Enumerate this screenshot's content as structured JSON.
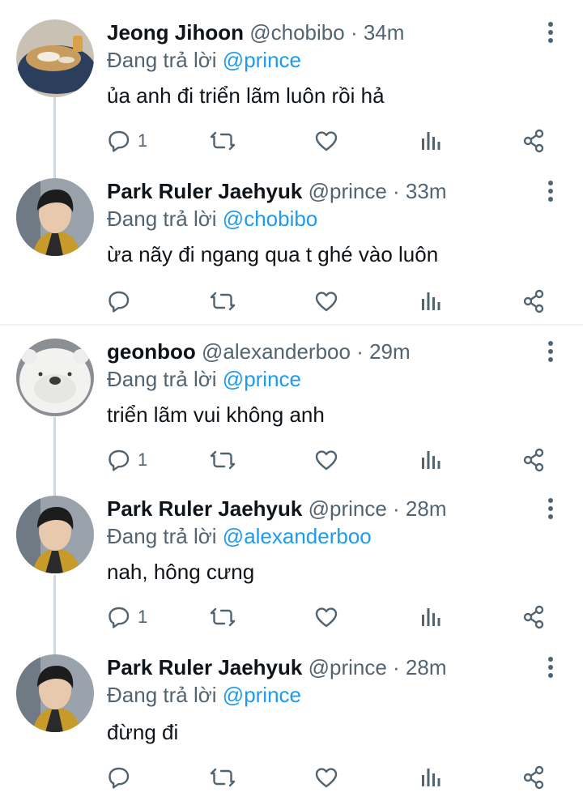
{
  "replying_label": "Đang trả lời",
  "tweets": [
    {
      "name": "Jeong Jihoon",
      "handle": "@chobibo",
      "time": "· 34m",
      "reply_to": "@prince",
      "text": "ủa anh đi triển lãm luôn rồi hả",
      "reply_count": "1",
      "avatar": "food-photo"
    },
    {
      "name": "Park Ruler Jaehyuk",
      "handle": "@prince",
      "time": "· 33m",
      "reply_to": "@chobibo",
      "text": "ừa nãy đi ngang qua t ghé vào luôn",
      "reply_count": "",
      "avatar": "person-photo"
    },
    {
      "name": "geonboo",
      "handle": "@alexanderboo",
      "time": "· 29m",
      "reply_to": "@prince",
      "text": "triển lãm vui không anh",
      "reply_count": "1",
      "avatar": "bear-plush-photo"
    },
    {
      "name": "Park Ruler Jaehyuk",
      "handle": "@prince",
      "time": "· 28m",
      "reply_to": "@alexanderboo",
      "text": "nah, hông cưng",
      "reply_count": "1",
      "avatar": "person-photo"
    },
    {
      "name": "Park Ruler Jaehyuk",
      "handle": "@prince",
      "time": "· 28m",
      "reply_to": "@prince",
      "text": "đừng đi",
      "reply_count": "",
      "avatar": "person-photo"
    }
  ],
  "colors": {
    "accent": "#1d9bf0",
    "secondary_text": "#536471",
    "thread_line": "#cfd9de"
  }
}
